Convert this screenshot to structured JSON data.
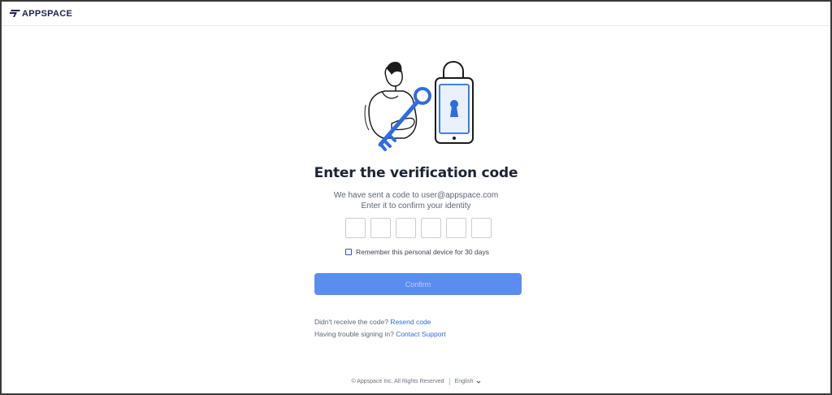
{
  "brand": {
    "name": "APPSPACE",
    "color": "#1a2350"
  },
  "illustration": {
    "icons": [
      "person-icon",
      "key-icon",
      "padlock-phone-icon"
    ],
    "accent": "#2f6ce0"
  },
  "title": "Enter the verification code",
  "subtitle": {
    "line1": "We have sent a code to user@appspace.com",
    "line2": "Enter it to confirm your identity"
  },
  "code_inputs": {
    "count": 6,
    "values": [
      "",
      "",
      "",
      "",
      "",
      ""
    ]
  },
  "remember": {
    "label": "Remember this personal device for 30 days",
    "checked": false
  },
  "confirm": {
    "label": "Confirm",
    "color": "#5b8df0"
  },
  "help": {
    "resend_prefix": "Didn't receive the code?",
    "resend_link": "Resend code",
    "support_prefix": "Having trouble signing in?",
    "support_link": "Contact Support",
    "link_color": "#2f6ce0"
  },
  "footer": {
    "copyright": "© Appspace Inc. All Rights Reserved",
    "language": "English"
  }
}
